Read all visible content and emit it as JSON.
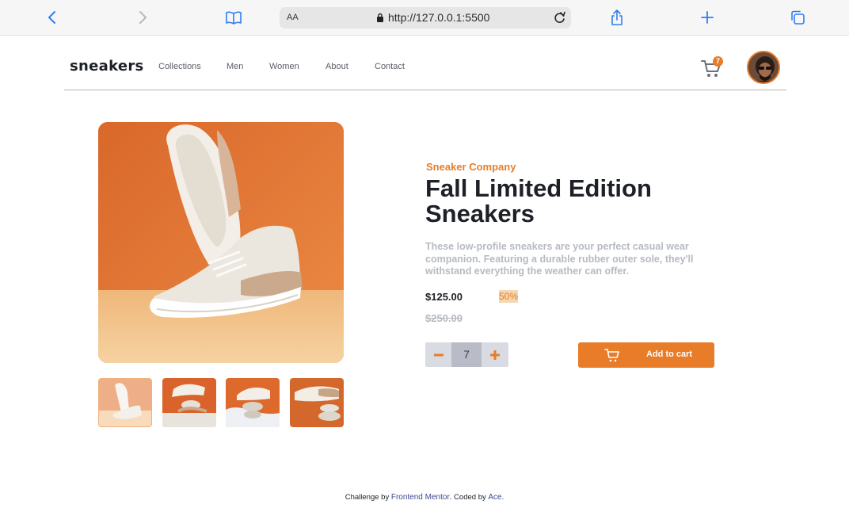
{
  "browser": {
    "url": "http://127.0.0.1:5500",
    "text_size_label": "AA"
  },
  "header": {
    "logo": "sneakers",
    "nav": [
      "Collections",
      "Men",
      "Women",
      "About",
      "Contact"
    ],
    "cart_count": "7"
  },
  "product": {
    "company": "Sneaker Company",
    "title": "Fall Limited Edition Sneakers",
    "description": "These low-profile sneakers are your perfect casual wear companion. Featuring a durable rubber outer sole, they'll withstand everything the weather can offer.",
    "price": "$125.00",
    "discount": "50%",
    "old_price": "$250.00",
    "quantity": "7",
    "add_to_cart_label": "Add to cart"
  },
  "footer": {
    "prefix": "Challenge by",
    "fm_link": "Frontend Mentor",
    "middle": ". Coded by",
    "author_link": "Ace",
    "suffix": "."
  },
  "colors": {
    "accent": "#e87c28",
    "dark": "#1d2026",
    "muted": "#b6bac2"
  }
}
